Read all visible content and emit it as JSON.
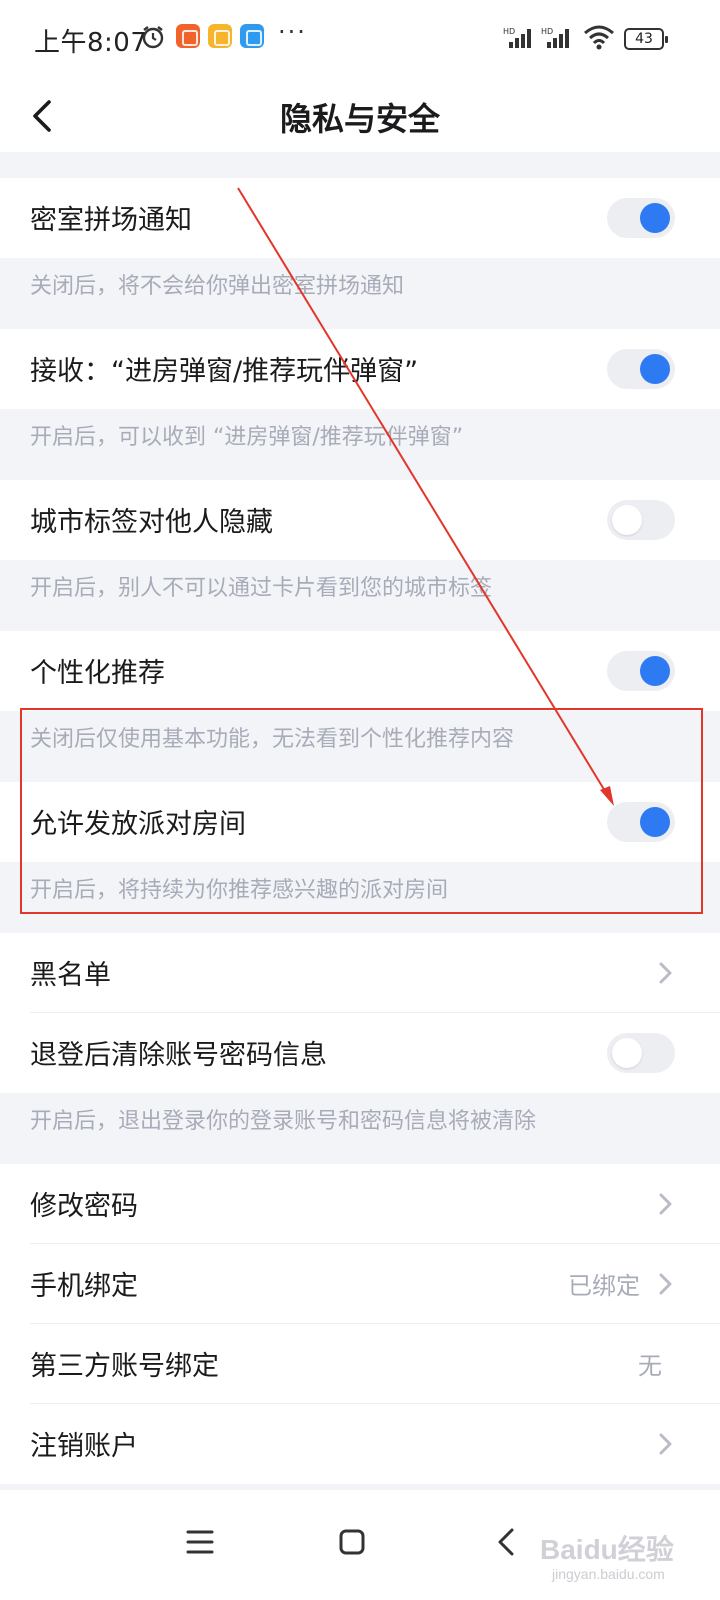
{
  "status_bar": {
    "time": "上午8:07",
    "more": "···",
    "battery": "43"
  },
  "header": {
    "title": "隐私与安全"
  },
  "settings": [
    {
      "label": "密室拼场通知",
      "type": "toggle",
      "on": true,
      "description": "关闭后，将不会给你弹出密室拼场通知"
    },
    {
      "label": "接收：“进房弹窗/推荐玩伴弹窗”",
      "type": "toggle",
      "on": true,
      "description": "开启后，可以收到 “进房弹窗/推荐玩伴弹窗”"
    },
    {
      "label": "城市标签对他人隐藏",
      "type": "toggle",
      "on": false,
      "description": "开启后，别人不可以通过卡片看到您的城市标签"
    },
    {
      "label": "个性化推荐",
      "type": "toggle",
      "on": true,
      "description": "关闭后仅使用基本功能，无法看到个性化推荐内容"
    },
    {
      "label": "允许发放派对房间",
      "type": "toggle",
      "on": true,
      "description": "开启后，将持续为你推荐感兴趣的派对房间"
    },
    {
      "label": "黑名单",
      "type": "link"
    },
    {
      "label": "退登后清除账号密码信息",
      "type": "toggle",
      "on": false,
      "description": "开启后，退出登录你的登录账号和密码信息将被清除"
    },
    {
      "label": "修改密码",
      "type": "link"
    },
    {
      "label": "手机绑定",
      "type": "link",
      "value": "已绑定"
    },
    {
      "label": "第三方账号绑定",
      "type": "value",
      "value": "无"
    },
    {
      "label": "注销账户",
      "type": "link"
    }
  ],
  "watermark": {
    "text": "Baidu经验",
    "sub": "jingyan.baidu.com"
  },
  "colors": {
    "accent": "#2e7af2",
    "annotation": "#e2362a",
    "background": "#f3f4f8"
  }
}
